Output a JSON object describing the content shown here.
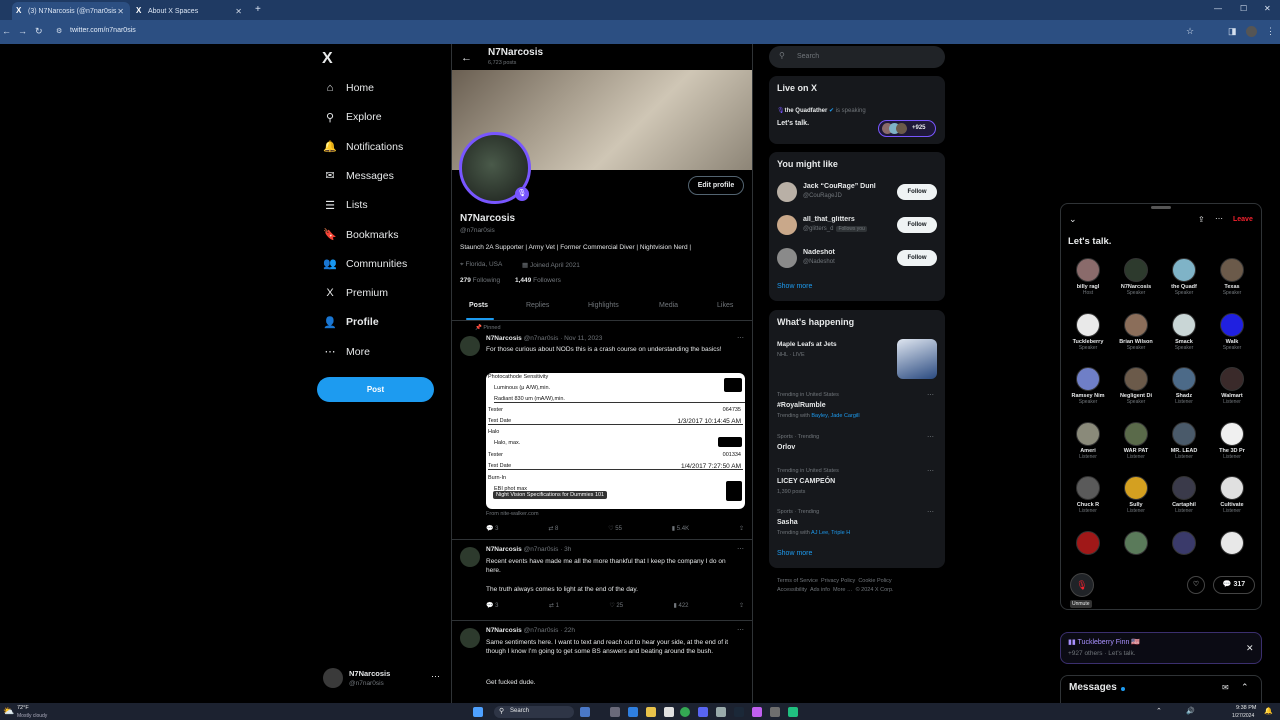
{
  "browser": {
    "tabs": [
      {
        "label": "(3) N7Narcosis (@n7nar0sis",
        "active": true
      },
      {
        "label": "About X Spaces",
        "active": false
      }
    ],
    "new_tab": "+",
    "url": "twitter.com/n7nar0sis"
  },
  "nav": {
    "logo": "X",
    "items": [
      {
        "label": "Home",
        "icon": "home-icon",
        "glyph": "⌂"
      },
      {
        "label": "Explore",
        "icon": "search-icon",
        "glyph": "⚲"
      },
      {
        "label": "Notifications",
        "icon": "bell-icon",
        "glyph": "🔔"
      },
      {
        "label": "Messages",
        "icon": "mail-icon",
        "glyph": "✉"
      },
      {
        "label": "Lists",
        "icon": "list-icon",
        "glyph": "☰"
      },
      {
        "label": "Bookmarks",
        "icon": "bookmark-icon",
        "glyph": "🔖"
      },
      {
        "label": "Communities",
        "icon": "people-icon",
        "glyph": "👥"
      },
      {
        "label": "Premium",
        "icon": "x-logo-icon",
        "glyph": "X"
      },
      {
        "label": "Profile",
        "icon": "person-icon",
        "glyph": "👤"
      },
      {
        "label": "More",
        "icon": "more-circle-icon",
        "glyph": "⋯"
      }
    ],
    "post_button": "Post",
    "account": {
      "name": "N7Narcosis",
      "handle": "@n7nar0sis"
    }
  },
  "profile": {
    "header_name": "N7Narcosis",
    "post_count": "6,723 posts",
    "name": "N7Narcosis",
    "handle": "@n7nar0sis",
    "edit_button": "Edit profile",
    "bio": "Staunch 2A Supporter | Army Vet | Former Commercial Diver | Nightvision Nerd |",
    "location": "Florida, USA",
    "joined": "Joined April 2021",
    "following_count": "279",
    "following_label": "Following",
    "followers_count": "1,449",
    "followers_label": "Followers",
    "tabs": [
      "Posts",
      "Replies",
      "Highlights",
      "Media",
      "Likes"
    ]
  },
  "tweets": [
    {
      "pinned": "Pinned",
      "name": "N7Narcosis",
      "handle": "@n7nar0sis",
      "time": "Nov 11, 2023",
      "text": "For those curious about NODs this is a crash course on understanding the basics!",
      "card_caption": "Night Vision Specifications for Dummies 101",
      "card_source": "From nite-walker.com",
      "doc_rows": [
        "Photocathode Sensitivity",
        "Luminous (μ A/W),min.",
        "Radiant 830 um (mA/W),min.",
        "Tester",
        "Test Date",
        "Halo",
        "Halo, max.",
        "Tester",
        "Test Date",
        "Burn-In",
        "EBI phot max"
      ],
      "doc_values": [
        "064735",
        "1/3/2017 10:14:45 AM",
        "001334",
        "1/4/2017 7:27:50 AM"
      ],
      "replies": "3",
      "reposts": "8",
      "likes": "55",
      "views": "5.4K"
    },
    {
      "name": "N7Narcosis",
      "handle": "@n7nar0sis",
      "time": "3h",
      "text": "Recent events have made me all the more thankful that I keep the company I do on here.",
      "text2": "The truth always comes to light at the end of the day.",
      "replies": "3",
      "reposts": "1",
      "likes": "25",
      "views": "422"
    },
    {
      "name": "N7Narcosis",
      "handle": "@n7nar0sis",
      "time": "22h",
      "text": "Same sentiments here. I want to text and reach out to hear your side, at the end of it though I know I'm going to get some BS answers and beating around the bush.",
      "text2": "Get fucked dude."
    }
  ],
  "search": {
    "placeholder": "Search"
  },
  "live": {
    "title": "Live on X",
    "host": "the Quadfather",
    "status": "is speaking",
    "topic": "Let's talk.",
    "count": "+925"
  },
  "suggestions": {
    "title": "You might like",
    "users": [
      {
        "name": "Jack “CouRage” Dunl",
        "handle": "@CouRageJD",
        "note": ""
      },
      {
        "name": "all_that_glitters",
        "handle": "@glitters_d",
        "note": "Follows you"
      },
      {
        "name": "Nadeshot",
        "handle": "@Nadeshot",
        "note": ""
      }
    ],
    "follow_label": "Follow",
    "show_more": "Show more"
  },
  "happening": {
    "title": "What's happening",
    "event": {
      "title": "Maple Leafs at Jets",
      "meta": "NHL · LIVE"
    },
    "trends": [
      {
        "meta": "Trending in United States",
        "title": "#RoyalRumble",
        "with_prefix": "Trending with",
        "with": "Bayley, Jade Cargill"
      },
      {
        "meta": "Sports · Trending",
        "title": "Orlov",
        "with_prefix": "",
        "with": ""
      },
      {
        "meta": "Trending in United States",
        "title": "LICEY CAMPEÓN",
        "with_prefix": "1,390 posts",
        "with": ""
      },
      {
        "meta": "Sports · Trending",
        "title": "Sasha",
        "with_prefix": "Trending with",
        "with": "AJ Lee, Triple H"
      }
    ],
    "show_more": "Show more"
  },
  "footer": {
    "line1": [
      "Terms of Service",
      "Privacy Policy",
      "Cookie Policy"
    ],
    "line2": [
      "Accessibility",
      "Ads info",
      "More …",
      "© 2024 X Corp."
    ]
  },
  "space": {
    "leave": "Leave",
    "title": "Let's talk.",
    "participants": [
      {
        "name": "billy ragl",
        "role": "Host",
        "color": "#8a6b6b"
      },
      {
        "name": "N7Narcosis",
        "role": "Speaker",
        "color": "#2d3a2d"
      },
      {
        "name": "the Quadf",
        "role": "Speaker",
        "color": "#7fb3c7"
      },
      {
        "name": "Texas",
        "role": "Speaker",
        "color": "#6b5a4a"
      },
      {
        "name": "Tuckleberry",
        "role": "Speaker",
        "color": "#e9e9e9"
      },
      {
        "name": "Brian Wilson",
        "role": "Speaker",
        "color": "#8b6e5a"
      },
      {
        "name": "Smack",
        "role": "Speaker",
        "color": "#c9d6d6"
      },
      {
        "name": "Walk",
        "role": "Speaker",
        "color": "#2020e0"
      },
      {
        "name": "Ramsey Nim",
        "role": "Speaker",
        "color": "#6f7fc7"
      },
      {
        "name": "Negligent Di",
        "role": "Speaker",
        "color": "#6b5a4a"
      },
      {
        "name": "Shadz",
        "role": "Listener",
        "color": "#4c6a88"
      },
      {
        "name": "Walmart",
        "role": "Listener",
        "color": "#3a2a2a"
      },
      {
        "name": "Ameri",
        "role": "Listener",
        "color": "#8a8a7a"
      },
      {
        "name": "WAR PAT",
        "role": "Listener",
        "color": "#5a6a4a"
      },
      {
        "name": "MR. LEAD",
        "role": "Listener",
        "color": "#4a5a6a"
      },
      {
        "name": "The 3D Pr",
        "role": "Listener",
        "color": "#f0f0f0"
      },
      {
        "name": "Chuck R",
        "role": "Listener",
        "color": "#5a5a5a"
      },
      {
        "name": "Sully",
        "role": "Listener",
        "color": "#d4a020"
      },
      {
        "name": "Cartaphil",
        "role": "Listener",
        "color": "#3a3a4a"
      },
      {
        "name": "Cultivate",
        "role": "Listener",
        "color": "#e0e0e0"
      },
      {
        "name": "",
        "role": "",
        "color": "#a01818"
      },
      {
        "name": "",
        "role": "",
        "color": "#5a7a5a"
      },
      {
        "name": "",
        "role": "",
        "color": "#3a3a6a"
      },
      {
        "name": "",
        "role": "",
        "color": "#e8e8e8"
      }
    ],
    "unmute": "Unmute",
    "comment_count": "317"
  },
  "space_dock": {
    "name": "Tuckleberry Finn",
    "flag": "🇺🇸",
    "subtitle": "+927 others · Let's talk."
  },
  "messages": {
    "title": "Messages"
  },
  "taskbar": {
    "temp": "72°F",
    "weather": "Mostly cloudy",
    "search": "Search",
    "time": "9:38 PM",
    "date": "1/27/2024"
  },
  "colors": {
    "accent": "#1d9bf0",
    "leave": "#f4212e",
    "space_purple": "#7856ff"
  }
}
